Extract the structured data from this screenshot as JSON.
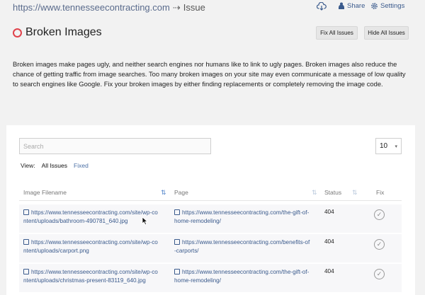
{
  "topbar": {
    "url": "https://www.tennesseecontracting.com",
    "sep": "⇢",
    "crumb": "Issue",
    "share": "Share",
    "settings": "Settings"
  },
  "header": {
    "title": "Broken Images",
    "fix_all": "Fix All Issues",
    "hide_all": "Hide All Issues"
  },
  "description": "Broken images make pages ugly, and neither search engines nor humans like to link to ugly pages. Broken images also reduce the chance of getting traffic from image searches. Too many broken images on your site may even communicate a message of low quality to search engines like Google. Fix your broken images by either finding replacements or completely removing the image code.",
  "controls": {
    "search_placeholder": "Search",
    "page_size": "10",
    "view_label": "View:",
    "all_issues": "All Issues",
    "fixed": "Fixed"
  },
  "table": {
    "columns": [
      "Image Filename",
      "Page",
      "Status",
      "Fix"
    ],
    "rows": [
      {
        "image_line1": "https://www.tennesseecontracting.com/site/wp-co",
        "image_line2": "ntent/uploads/bathroom-490781_640.jpg",
        "page_line1": "https://www.tennesseecontracting.com/the-gift-of-",
        "page_line2": "home-remodeling/",
        "status": "404"
      },
      {
        "image_line1": "https://www.tennesseecontracting.com/site/wp-co",
        "image_line2": "ntent/uploads/carport.png",
        "page_line1": "https://www.tennesseecontracting.com/benefits-of",
        "page_line2": "-carports/",
        "status": "404"
      },
      {
        "image_line1": "https://www.tennesseecontracting.com/site/wp-co",
        "image_line2": "ntent/uploads/christmas-present-83119_640.jpg",
        "page_line1": "https://www.tennesseecontracting.com/the-gift-of-",
        "page_line2": "home-remodeling/",
        "status": "404"
      }
    ]
  },
  "colors": {
    "accent": "#3a5a8c",
    "error_ring": "#e0424b",
    "background": "#f2f2f2"
  },
  "icons": [
    "cloud-download-icon",
    "share-icon",
    "gear-icon",
    "broken-ring-icon",
    "external-link-icon",
    "sort-icon",
    "check-circle-icon",
    "mouse-cursor-icon"
  ]
}
